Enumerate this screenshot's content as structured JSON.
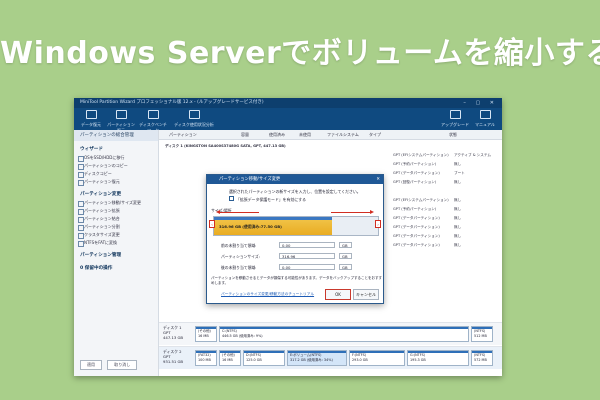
{
  "headline": "Windows Serverでボリュームを縮小する",
  "window": {
    "title": "MiniTool Partition Wizard プロフェッショナル版 12.x - (ルアップグレードサービス付き)"
  },
  "toolbar": {
    "items": [
      {
        "label": "データ復元",
        "icon": "data-recovery-icon"
      },
      {
        "label": "パーティション復元",
        "icon": "partition-recovery-icon"
      },
      {
        "label": "ディスクベンチマーク",
        "icon": "benchmark-icon"
      },
      {
        "label": "ディスク使用状況分析",
        "icon": "space-analyzer-icon"
      }
    ],
    "right_items": [
      {
        "label": "アップグレード",
        "icon": "upgrade-icon"
      },
      {
        "label": "マニュアル",
        "icon": "manual-icon"
      }
    ]
  },
  "left_panel": {
    "tab": "パーティションの総合管理",
    "sections": [
      {
        "title": "ウィザード",
        "items": [
          "OSをSSD/HDDに移行",
          "パーティションのコピー",
          "ディスクコピー",
          "パーティション復元"
        ]
      },
      {
        "title": "パーティション変更",
        "items": [
          "パーティション移動/サイズ変更",
          "パーティション拡張",
          "パーティション結合",
          "パーティション分割",
          "クラスタサイズ変更",
          "NTFSをFATに変換"
        ]
      },
      {
        "title": "パーティション管理",
        "items": []
      },
      {
        "title": "0 保留中の操作",
        "items": []
      }
    ],
    "apply_label": "適用",
    "undo_label": "取り消し"
  },
  "columns": [
    "パーティション",
    "容量",
    "使用済み",
    "未使用",
    "ファイルシステム",
    "タイプ",
    "状態"
  ],
  "list": {
    "disk1_header": "ディスク 1 (KINGSTON SA400S37480G SATA, GPT, 447.13 GB)",
    "rows": [
      {
        "type": "GPT (EFIシステムパーティション)",
        "status": "アクティブ & システム"
      },
      {
        "type": "GPT (予約パーティション)",
        "status": "無し"
      },
      {
        "type": "GPT (データパーティション)",
        "status": "ブート"
      },
      {
        "type": "GPT (回復パーティション)",
        "status": "無し"
      },
      {
        "type": "",
        "status": ""
      },
      {
        "type": "GPT (EFIシステムパーティション)",
        "status": "無し"
      },
      {
        "type": "GPT (予約パーティション)",
        "status": "無し"
      },
      {
        "type": "GPT (データパーティション)",
        "status": "無し"
      },
      {
        "type": "GPT (データパーティション)",
        "status": "無し"
      },
      {
        "type": "GPT (データパーティション)",
        "status": "無し"
      },
      {
        "type": "GPT (データパーティション)",
        "status": "無し"
      }
    ]
  },
  "disk_map": [
    {
      "label": "ディスク 1",
      "sub1": "GPT",
      "sub2": "447.13 GB",
      "segments": [
        {
          "name": "(その他)",
          "size": "16 MB"
        },
        {
          "name": "C:(NTFS)",
          "size": "446.5 GB (使用済み: 9%)"
        },
        {
          "name": "(NTFS)",
          "size": "512 MB"
        }
      ]
    },
    {
      "label": "ディスク 2",
      "sub1": "GPT",
      "sub2": "931.51 GB",
      "segments": [
        {
          "name": "(FAT32)",
          "size": "100 MB"
        },
        {
          "name": "(その他)",
          "size": "16 MB"
        },
        {
          "name": "D:(NTFS)",
          "size": "125.0 GB"
        },
        {
          "name": "E:ボリューム(NTFS)",
          "size": "317.2 GB (使用済み: 34%)"
        },
        {
          "name": "F:(NTFS)",
          "size": "293.0 GB"
        },
        {
          "name": "G:(NTFS)",
          "size": "195.3 GB"
        },
        {
          "name": "(NTFS)",
          "size": "572 MB"
        }
      ]
    }
  ],
  "dialog": {
    "title": "パーティション移動/サイズ変更",
    "description": "選択されたパーティションの新サイズを入力し、位置を設定してください。",
    "checkbox_label": "「拡張データ保護モード」を有効にする",
    "size_label": "サイズ/場所",
    "bar_label": "316.96 GB (使用済み:77.50 GB)",
    "fill_percent": 72,
    "fields": [
      {
        "label": "前の未割り当て領域:",
        "value": "0.00",
        "unit": "GB"
      },
      {
        "label": "パーティションサイズ:",
        "value": "316.96",
        "unit": "GB"
      },
      {
        "label": "後の未割り当て領域:",
        "value": "0.00",
        "unit": "GB"
      }
    ],
    "note": "パーティションを移動させるとデータが損傷する可能性があります。データをバックアップすることをおすすめします。",
    "tutorial_link": "パーティションのサイズ変更/移動方法のチュートリアル",
    "ok_label": "OK",
    "cancel_label": "キャンセル"
  }
}
